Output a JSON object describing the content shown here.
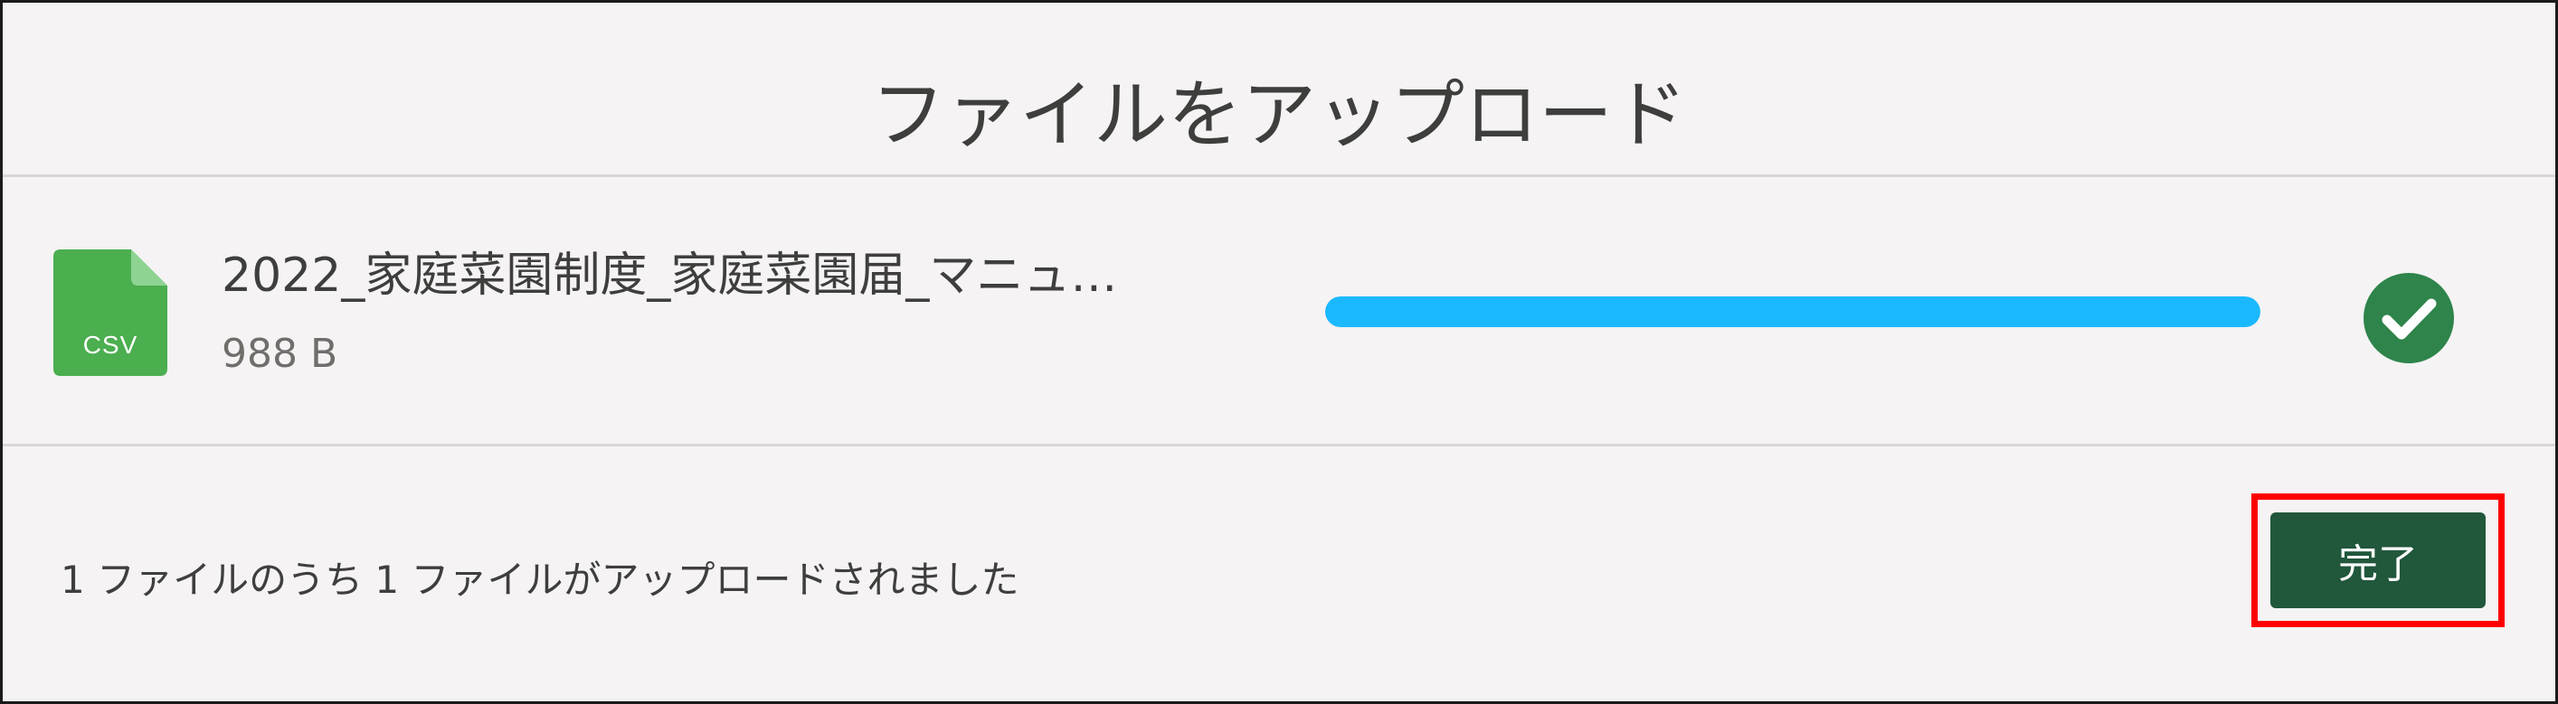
{
  "dialog": {
    "title": "ファイルをアップロード"
  },
  "file": {
    "icon": "csv-file-icon",
    "icon_label": "CSV",
    "icon_color": "#4bae4f",
    "name": "2022_家庭菜園制度_家庭菜園届_マニュ…",
    "size": "988 B",
    "progress_percent": 100,
    "progress_color": "#1ab9ff",
    "status_icon": "check-circle-icon",
    "status_color": "#2e844a"
  },
  "footer": {
    "status_text": "1 ファイルのうち 1 ファイルがアップロードされました",
    "done_label": "完了",
    "done_color": "#21573b",
    "highlight_color": "#ff0000"
  }
}
